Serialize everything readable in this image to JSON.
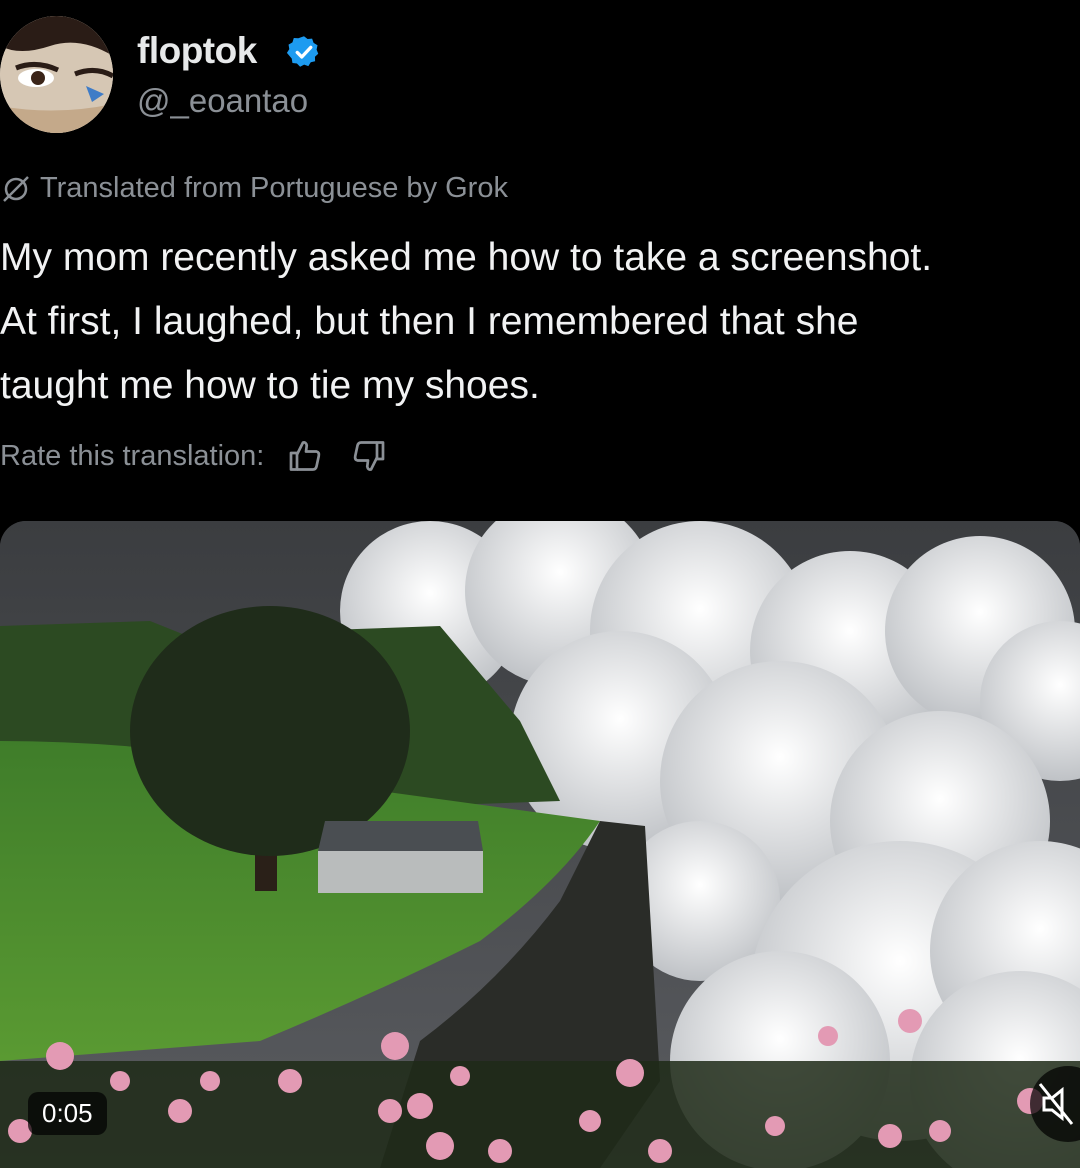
{
  "author": {
    "display_name": "floptok",
    "handle": "@_eoantao",
    "avatar_icon": "avatar-face",
    "verified_icon": "verified-badge-icon",
    "verified_color": "#1d9bf0"
  },
  "translation": {
    "notice": "Translated from Portuguese by Grok",
    "icon": "grok-icon",
    "rate_label": "Rate this translation:",
    "thumbs_up_icon": "thumbs-up-icon",
    "thumbs_down_icon": "thumbs-down-icon"
  },
  "tweet": {
    "text": "My mom recently asked me how to take a screenshot.\nAt first, I laughed, but then I remembered that she\ntaught me how to tie my shoes."
  },
  "media": {
    "type": "video",
    "timestamp": "0:05",
    "mute_icon": "speaker-muted-icon"
  },
  "colors": {
    "background": "#000000",
    "primary_text": "#e7e9ea",
    "secondary_text": "#8b9096",
    "accent": "#1d9bf0"
  }
}
